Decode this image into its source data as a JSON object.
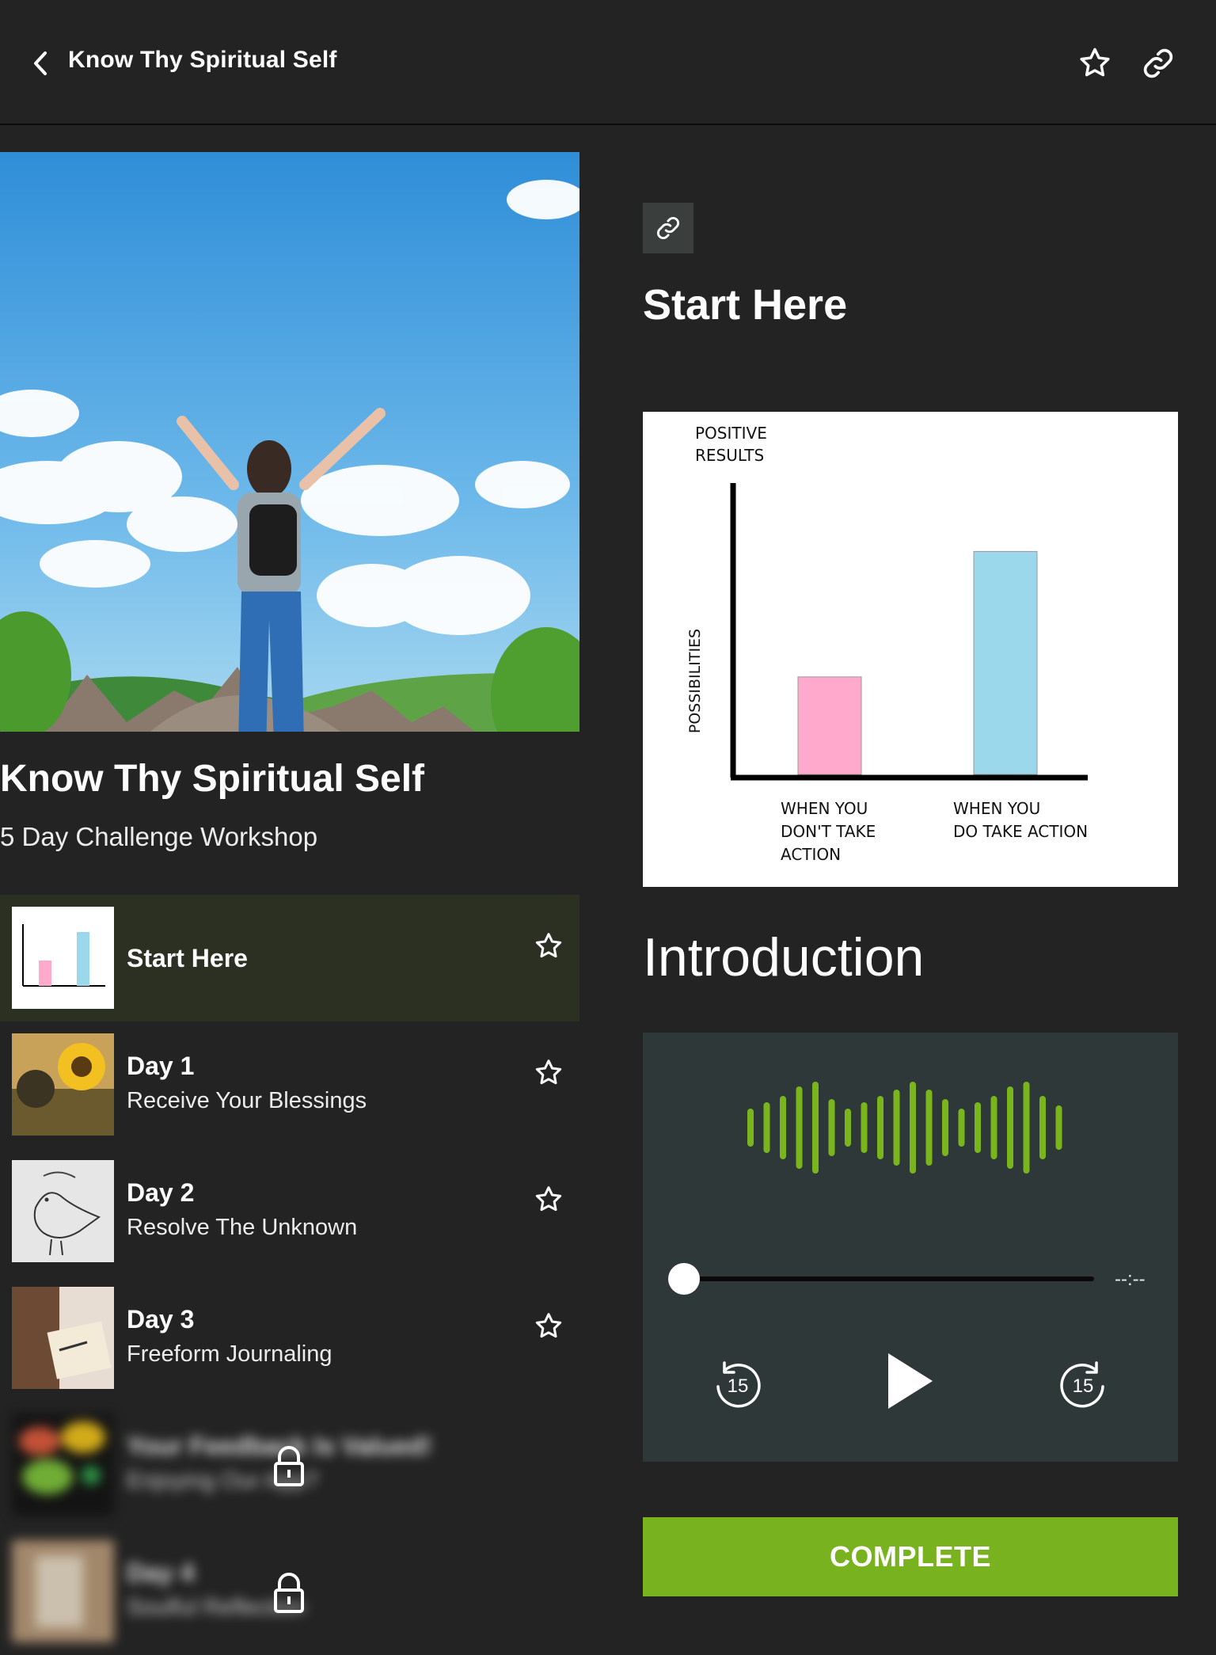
{
  "header": {
    "title": "Know Thy Spiritual Self",
    "icons": [
      "chevron-left-icon",
      "star-icon",
      "link-icon"
    ]
  },
  "course": {
    "title": "Know Thy Spiritual Self",
    "subtitle": "5 Day Challenge Workshop"
  },
  "lessons": [
    {
      "title": "Start Here",
      "subtitle": "",
      "active": true,
      "locked": false
    },
    {
      "title": "Day 1",
      "subtitle": "Receive Your Blessings",
      "active": false,
      "locked": false
    },
    {
      "title": "Day 2",
      "subtitle": "Resolve The Unknown",
      "active": false,
      "locked": false
    },
    {
      "title": "Day 3",
      "subtitle": "Freeform Journaling",
      "active": false,
      "locked": false
    },
    {
      "title": "Your Feedback Is Valued!",
      "subtitle": "Enjoying Our App?",
      "active": false,
      "locked": true
    },
    {
      "title": "Day 4",
      "subtitle": "Soulful Reflection",
      "active": false,
      "locked": true
    }
  ],
  "lesson_detail": {
    "title": "Start Here",
    "section_heading": "Introduction"
  },
  "chart_data": {
    "type": "bar",
    "categories": [
      "WHEN YOU DON'T TAKE ACTION",
      "WHEN YOU DO TAKE ACTION"
    ],
    "category_lines": [
      [
        "WHEN YOU",
        "DON'T TAKE",
        "ACTION"
      ],
      [
        "WHEN YOU",
        "DO TAKE ACTION"
      ]
    ],
    "values": [
      0.35,
      0.8
    ],
    "colors": [
      "#ffaacc",
      "#9bd8ec"
    ],
    "title_lines": [
      "POSITIVE",
      "RESULTS"
    ],
    "ylabel": "POSSIBILITIES",
    "xlabel": "",
    "ylim": [
      0,
      1
    ],
    "grid": false
  },
  "player": {
    "time": "--:--",
    "progress": 0,
    "rewind_label": "15",
    "forward_label": "15",
    "wave_color": "#7ab51d"
  },
  "actions": {
    "complete_label": "COMPLETE"
  },
  "colors": {
    "background": "#232323",
    "active_row": "#2b3022",
    "accent": "#79b21f",
    "player_bg": "#2e3838"
  }
}
